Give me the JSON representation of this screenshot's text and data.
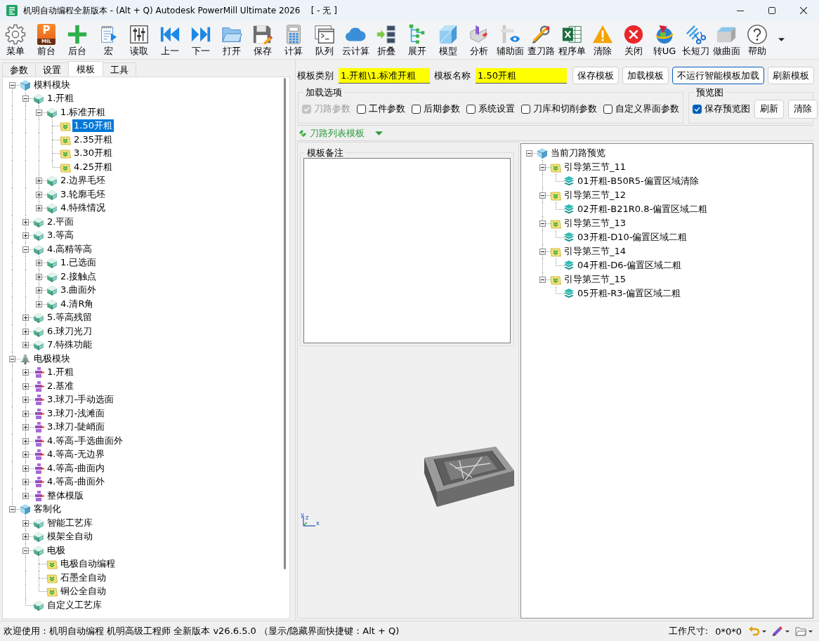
{
  "window": {
    "title": "机明自动编程全新版本 - (Alt + Q) Autodesk PowerMill Ultimate 2026    [ - 无 ]"
  },
  "toolbar": [
    {
      "label": "菜单",
      "kind": "settings"
    },
    {
      "label": "前台",
      "kind": "app",
      "logo": "P",
      "logo_caption": "MIL"
    },
    {
      "label": "后台",
      "kind": "add"
    },
    {
      "label": "宏",
      "kind": "macro"
    },
    {
      "label": "读取",
      "kind": "mixer"
    },
    {
      "label": "上一",
      "kind": "previous"
    },
    {
      "label": "下一",
      "kind": "next"
    },
    {
      "label": "打开",
      "kind": "open"
    },
    {
      "label": "保存",
      "kind": "save"
    },
    {
      "label": "计算",
      "kind": "calculator"
    },
    {
      "label": "队列",
      "kind": "queue"
    },
    {
      "label": "云计算",
      "kind": "cloud"
    },
    {
      "label": "折叠",
      "kind": "collapse"
    },
    {
      "label": "展开",
      "kind": "expand"
    },
    {
      "label": "模型",
      "kind": "model"
    },
    {
      "label": "分析",
      "kind": "analyze"
    },
    {
      "label": "辅助面",
      "kind": "aux"
    },
    {
      "label": "查刀路",
      "kind": "tools"
    },
    {
      "label": "程序单",
      "kind": "spreadsheet"
    },
    {
      "label": "清除",
      "kind": "warning"
    },
    {
      "label": "关闭",
      "kind": "close"
    },
    {
      "label": "转UG",
      "kind": "convert"
    },
    {
      "label": "长短刀",
      "kind": "cutter"
    },
    {
      "label": "做曲面",
      "kind": "surface"
    },
    {
      "label": "帮助",
      "kind": "help"
    }
  ],
  "left_panel": {
    "tabs": [
      {
        "label": "参数",
        "selected": false
      },
      {
        "label": "设置",
        "selected": false
      },
      {
        "label": "模板",
        "selected": true
      },
      {
        "label": "工具",
        "selected": false
      }
    ],
    "tree": [
      {
        "label": "模料模块",
        "kind": "module",
        "expanded": true,
        "selected": false,
        "children": [
          {
            "label": "1.开粗",
            "kind": "group",
            "expanded": true,
            "selected": false,
            "children": [
              {
                "label": "1.标准开粗",
                "kind": "group",
                "expanded": true,
                "selected": false,
                "children": [
                  {
                    "label": "1.50开粗",
                    "kind": "template",
                    "selected": true
                  },
                  {
                    "label": "2.35开粗",
                    "kind": "template",
                    "selected": false
                  },
                  {
                    "label": "3.30开粗",
                    "kind": "template",
                    "selected": false
                  },
                  {
                    "label": "4.25开粗",
                    "kind": "template",
                    "selected": false
                  }
                ]
              },
              {
                "label": "2.边界毛坯",
                "kind": "group",
                "expanded": false,
                "selected": false
              },
              {
                "label": "3.轮廓毛坯",
                "kind": "group",
                "expanded": false,
                "selected": false
              },
              {
                "label": "4.特殊情况",
                "kind": "group",
                "expanded": false,
                "selected": false
              }
            ]
          },
          {
            "label": "2.平面",
            "kind": "group",
            "expanded": false,
            "selected": false
          },
          {
            "label": "3.等高",
            "kind": "group",
            "expanded": false,
            "selected": false
          },
          {
            "label": "4.高精等高",
            "kind": "group",
            "expanded": true,
            "selected": false,
            "children": [
              {
                "label": "1.已选面",
                "kind": "group",
                "expanded": false,
                "selected": false
              },
              {
                "label": "2.接触点",
                "kind": "group",
                "expanded": false,
                "selected": false
              },
              {
                "label": "3.曲面外",
                "kind": "group",
                "expanded": false,
                "selected": false
              },
              {
                "label": "4.清R角",
                "kind": "group",
                "expanded": false,
                "selected": false
              }
            ]
          },
          {
            "label": "5.等高残留",
            "kind": "group",
            "expanded": false,
            "selected": false
          },
          {
            "label": "6.球刀光刀",
            "kind": "group",
            "expanded": false,
            "selected": false
          },
          {
            "label": "7.特殊功能",
            "kind": "group",
            "expanded": false,
            "selected": false
          }
        ]
      },
      {
        "label": "电极模块",
        "kind": "electrode_module",
        "expanded": true,
        "selected": false,
        "children": [
          {
            "label": "1.开粗",
            "kind": "electrode_group",
            "expanded": false,
            "selected": false
          },
          {
            "label": "2.基准",
            "kind": "electrode_group",
            "expanded": false,
            "selected": false
          },
          {
            "label": "3.球刀-手动选面",
            "kind": "electrode_group",
            "expanded": false,
            "selected": false
          },
          {
            "label": "3.球刀-浅滩面",
            "kind": "electrode_group",
            "expanded": false,
            "selected": false
          },
          {
            "label": "3.球刀-陡峭面",
            "kind": "electrode_group",
            "expanded": false,
            "selected": false
          },
          {
            "label": "4.等高-手选曲面外",
            "kind": "electrode_group",
            "expanded": false,
            "selected": false
          },
          {
            "label": "4.等高-无边界",
            "kind": "electrode_group",
            "expanded": false,
            "selected": false
          },
          {
            "label": "4.等高-曲面内",
            "kind": "electrode_group",
            "expanded": false,
            "selected": false
          },
          {
            "label": "4.等高-曲面外",
            "kind": "electrode_group",
            "expanded": false,
            "selected": false
          },
          {
            "label": "整体模版",
            "kind": "electrode_group",
            "expanded": false,
            "selected": false
          }
        ]
      },
      {
        "label": "客制化",
        "kind": "module",
        "expanded": true,
        "selected": false,
        "children": [
          {
            "label": "智能工艺库",
            "kind": "group",
            "expanded": false,
            "selected": false
          },
          {
            "label": "模架全自动",
            "kind": "group",
            "expanded": false,
            "selected": false
          },
          {
            "label": "电极",
            "kind": "group",
            "expanded": true,
            "selected": false,
            "children": [
              {
                "label": "电极自动编程",
                "kind": "template",
                "selected": false
              },
              {
                "label": "石墨全自动",
                "kind": "template",
                "selected": false
              },
              {
                "label": "铜公全自动",
                "kind": "template",
                "selected": false
              }
            ]
          },
          {
            "label": "自定义工艺库",
            "kind": "group",
            "selected": false
          }
        ]
      }
    ]
  },
  "template_bar": {
    "category": {
      "label": "模板类别",
      "value": "1.开粗\\1.标准开粗"
    },
    "name": {
      "label": "模板名称",
      "value": "1.50开粗"
    },
    "buttons": [
      {
        "label": "保存模板",
        "focused": false
      },
      {
        "label": "加载模板",
        "focused": false
      },
      {
        "label": "不运行智能模板加载",
        "focused": true
      },
      {
        "label": "刷新模板",
        "focused": false
      }
    ]
  },
  "load_options": {
    "title": "加载选项",
    "options": [
      {
        "label": "刀路参数",
        "checked": true,
        "disabled": true
      },
      {
        "label": "工件参数",
        "checked": false,
        "disabled": false
      },
      {
        "label": "后期参数",
        "checked": false,
        "disabled": false
      },
      {
        "label": "系统设置",
        "checked": false,
        "disabled": false
      },
      {
        "label": "刀库和切削参数",
        "checked": false,
        "disabled": false
      },
      {
        "label": "自定义界面参数",
        "checked": false,
        "disabled": false
      }
    ]
  },
  "preview_image": {
    "title": "预览图",
    "save_preview": {
      "label": "保存预览图",
      "checked": true
    },
    "buttons": [
      "刷新",
      "清除"
    ]
  },
  "toolpath_template": {
    "label": "刀路列表模板"
  },
  "template_notes": {
    "title": "模板备注"
  },
  "viewport": {
    "axis_labels": [
      "y",
      "z",
      "x"
    ]
  },
  "toolpath_preview": {
    "tree": [
      {
        "label": "当前刀路预览",
        "kind": "module",
        "expanded": true,
        "selected": false,
        "children": [
          {
            "label": "引导第三节_11",
            "kind": "template",
            "expanded": true,
            "selected": false,
            "children": [
              {
                "label": "01开粗-B50R5-偏置区域清除",
                "kind": "toolpath",
                "selected": false
              }
            ]
          },
          {
            "label": "引导第三节_12",
            "kind": "template",
            "expanded": true,
            "selected": false,
            "children": [
              {
                "label": "02开粗-B21R0.8-偏置区域二粗",
                "kind": "toolpath",
                "selected": false
              }
            ]
          },
          {
            "label": "引导第三节_13",
            "kind": "template",
            "expanded": true,
            "selected": false,
            "children": [
              {
                "label": "03开粗-D10-偏置区域二粗",
                "kind": "toolpath",
                "selected": false
              }
            ]
          },
          {
            "label": "引导第三节_14",
            "kind": "template",
            "expanded": true,
            "selected": false,
            "children": [
              {
                "label": "04开粗-D6-偏置区域二粗",
                "kind": "toolpath",
                "selected": false
              }
            ]
          },
          {
            "label": "引导第三节_15",
            "kind": "template",
            "expanded": true,
            "selected": false,
            "children": [
              {
                "label": "05开粗-R3-偏置区域二粗",
                "kind": "toolpath",
                "selected": false
              }
            ]
          }
        ]
      }
    ]
  },
  "status_bar": {
    "message": "欢迎使用：机明自动编程 机明高级工程师 全新版本 v26.6.5.0 （显示/隐藏界面快捷键：Alt + Q)",
    "work_size_label": "工作尺寸:",
    "work_size_value": "0*0*0"
  }
}
